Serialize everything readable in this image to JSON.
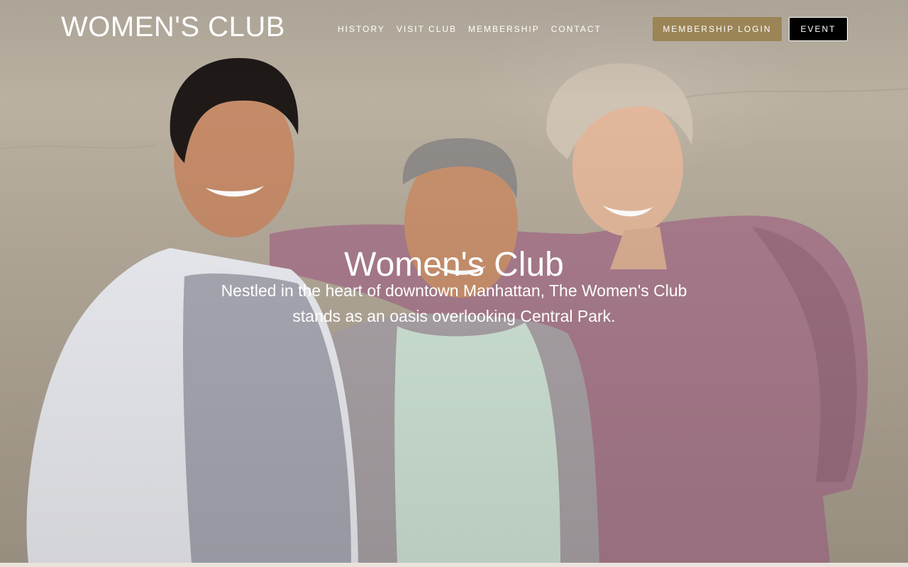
{
  "header": {
    "brand": "WOMEN'S CLUB",
    "nav": [
      "HISTORY",
      "VISIT CLUB",
      "MEMBERSHIP",
      "CONTACT"
    ],
    "login_label": "MEMBERSHIP LOGIN",
    "event_label": "EVENT",
    "login_color": "#9b8456",
    "event_color": "#000000"
  },
  "hero": {
    "title": "Women's Club",
    "subtitle": "Nestled in the heart of downtown Manhattan, The Women's Club stands as an oasis overlooking Central Park."
  }
}
